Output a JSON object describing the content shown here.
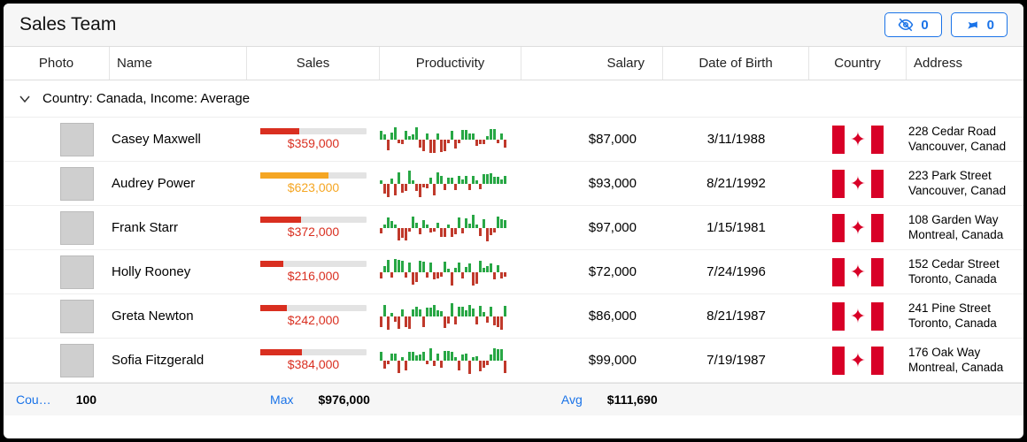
{
  "header": {
    "title": "Sales Team",
    "hide_count": "0",
    "pin_count": "0"
  },
  "columns": {
    "photo": "Photo",
    "name": "Name",
    "sales": "Sales",
    "productivity": "Productivity",
    "salary": "Salary",
    "dob": "Date of Birth",
    "country": "Country",
    "address": "Address"
  },
  "group": {
    "label": "Country: Canada, Income: Average"
  },
  "rows": [
    {
      "name": "Casey Maxwell",
      "sales_text": "$359,000",
      "sales_pct": 37,
      "sales_color": "red",
      "salary": "$87,000",
      "dob": "3/11/1988",
      "country": "Canada",
      "addr1": "228 Cedar Road",
      "addr2": "Vancouver, Canad"
    },
    {
      "name": "Audrey Power",
      "sales_text": "$623,000",
      "sales_pct": 64,
      "sales_color": "orange",
      "salary": "$93,000",
      "dob": "8/21/1992",
      "country": "Canada",
      "addr1": "223 Park Street",
      "addr2": "Vancouver, Canad"
    },
    {
      "name": "Frank Starr",
      "sales_text": "$372,000",
      "sales_pct": 38,
      "sales_color": "red",
      "salary": "$97,000",
      "dob": "1/15/1981",
      "country": "Canada",
      "addr1": "108 Garden Way",
      "addr2": "Montreal, Canada"
    },
    {
      "name": "Holly Rooney",
      "sales_text": "$216,000",
      "sales_pct": 22,
      "sales_color": "red",
      "salary": "$72,000",
      "dob": "7/24/1996",
      "country": "Canada",
      "addr1": "152 Cedar Street",
      "addr2": "Toronto, Canada"
    },
    {
      "name": "Greta Newton",
      "sales_text": "$242,000",
      "sales_pct": 25,
      "sales_color": "red",
      "salary": "$86,000",
      "dob": "8/21/1987",
      "country": "Canada",
      "addr1": "241 Pine Street",
      "addr2": "Toronto, Canada"
    },
    {
      "name": "Sofia Fitzgerald",
      "sales_text": "$384,000",
      "sales_pct": 39,
      "sales_color": "red",
      "salary": "$99,000",
      "dob": "7/19/1987",
      "country": "Canada",
      "addr1": "176 Oak Way",
      "addr2": "Montreal, Canada"
    }
  ],
  "footer": {
    "count_label": "Cou…",
    "count_value": "100",
    "max_label": "Max",
    "max_value": "$976,000",
    "avg_label": "Avg",
    "avg_value": "$111,690"
  }
}
